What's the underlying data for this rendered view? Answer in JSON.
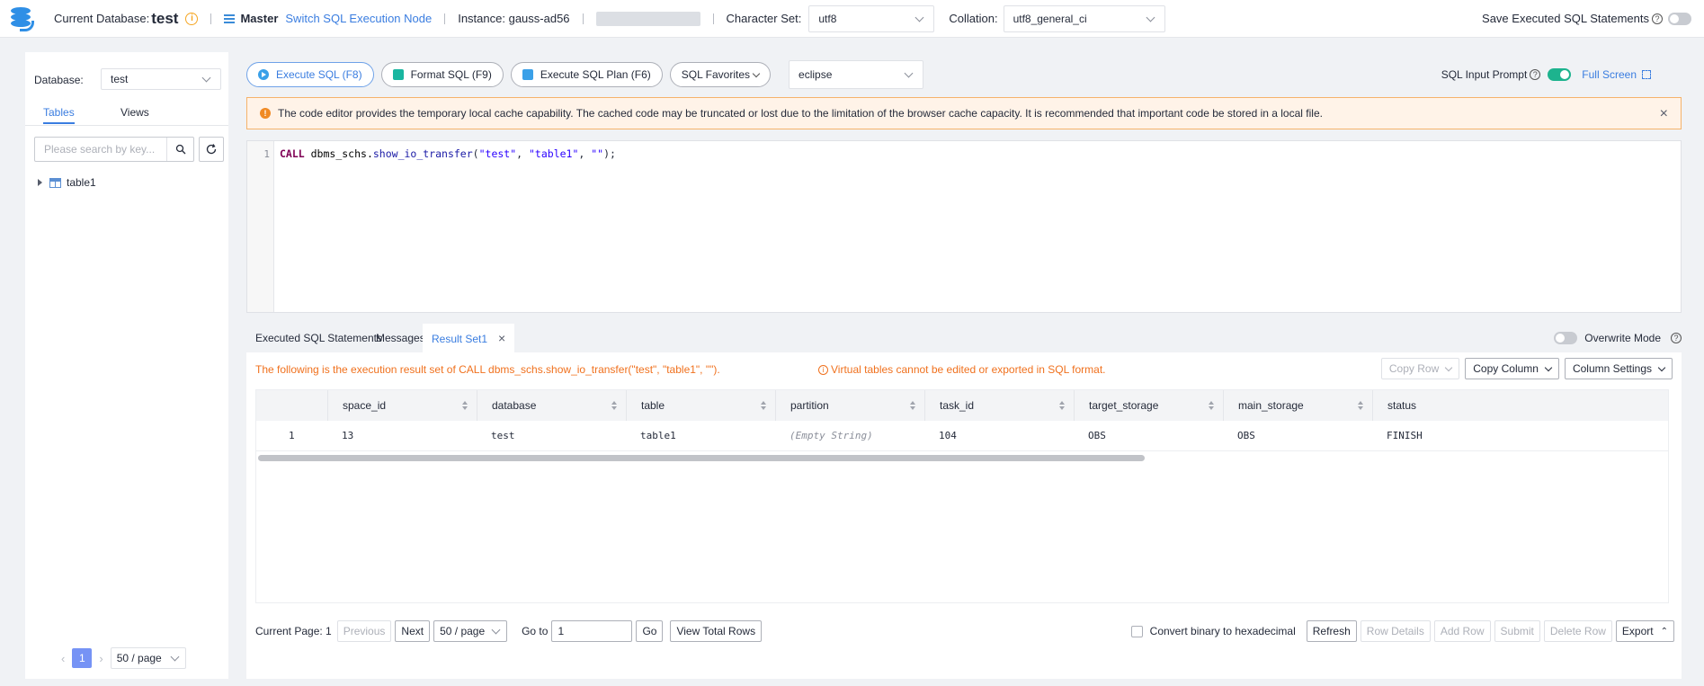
{
  "topbar": {
    "current_db_label": "Current Database:",
    "current_db_value": "test",
    "master_label": "Master",
    "switch_node_link": "Switch SQL Execution Node",
    "instance_label": "Instance: gauss-ad56",
    "charset_label": "Character Set:",
    "charset_value": "utf8",
    "collation_label": "Collation:",
    "collation_value": "utf8_general_ci",
    "save_executed_label": "Save Executed SQL Statements",
    "info_icon": "info-circle-icon",
    "accent_color": "#3a7de0"
  },
  "sidebar": {
    "database_label": "Database:",
    "database_value": "test",
    "tabs": [
      {
        "label": "Tables",
        "active": true
      },
      {
        "label": "Views",
        "active": false
      }
    ],
    "search_placeholder": "Please search by key...",
    "tree": [
      {
        "label": "table1",
        "icon": "table-icon"
      }
    ],
    "pager": {
      "page": "1",
      "page_size": "50 / page"
    }
  },
  "toolbar": {
    "execute_sql": "Execute SQL (F8)",
    "format_sql": "Format SQL (F9)",
    "execute_plan": "Execute SQL Plan (F6)",
    "favorites": "SQL Favorites",
    "theme_value": "eclipse",
    "input_prompt_label": "SQL Input Prompt",
    "input_prompt_on": true,
    "full_screen": "Full Screen"
  },
  "notice": {
    "text": "The code editor provides the temporary local cache capability. The cached code may be truncated or lost due to the limitation of the browser cache capacity. It is recommended that important code be stored in a local file."
  },
  "editor": {
    "line_number": "1",
    "code_keyword": "CALL",
    "code_schema": " dbms_schs.",
    "code_func": "show_io_transfer",
    "code_args_open": "(",
    "code_arg1": "\"test\"",
    "code_sep1": ", ",
    "code_arg2": "\"table1\"",
    "code_sep2": ", ",
    "code_arg3": "\"\"",
    "code_close": ");"
  },
  "result_tabs": {
    "tabs": [
      {
        "label": "Executed SQL Statements"
      },
      {
        "label": "Messages"
      },
      {
        "label": "Result Set1",
        "active": true
      }
    ],
    "overwrite_label": "Overwrite Mode"
  },
  "result": {
    "message": "The following is the execution result set of CALL dbms_schs.show_io_transfer(\"test\", \"table1\", \"\").",
    "virtual_warning": "Virtual tables cannot be edited or exported in SQL format.",
    "buttons": {
      "copy_row": "Copy Row",
      "copy_column": "Copy Column",
      "column_settings": "Column Settings"
    },
    "columns": [
      "",
      "space_id",
      "database",
      "table",
      "partition",
      "task_id",
      "target_storage",
      "main_storage",
      "status"
    ],
    "rows": [
      [
        "1",
        "13",
        "test",
        "table1",
        "(Empty String)",
        "104",
        "OBS",
        "OBS",
        "FINISH"
      ]
    ]
  },
  "bottom": {
    "current_page": "Current Page: 1",
    "previous": "Previous",
    "next": "Next",
    "page_size": "50 / page",
    "goto_label": "Go to",
    "goto_value": "1",
    "go": "Go",
    "view_total": "View Total Rows",
    "convert_binary": "Convert binary to hexadecimal",
    "refresh": "Refresh",
    "row_details": "Row Details",
    "add_row": "Add Row",
    "submit": "Submit",
    "delete_row": "Delete Row",
    "export": "Export"
  }
}
